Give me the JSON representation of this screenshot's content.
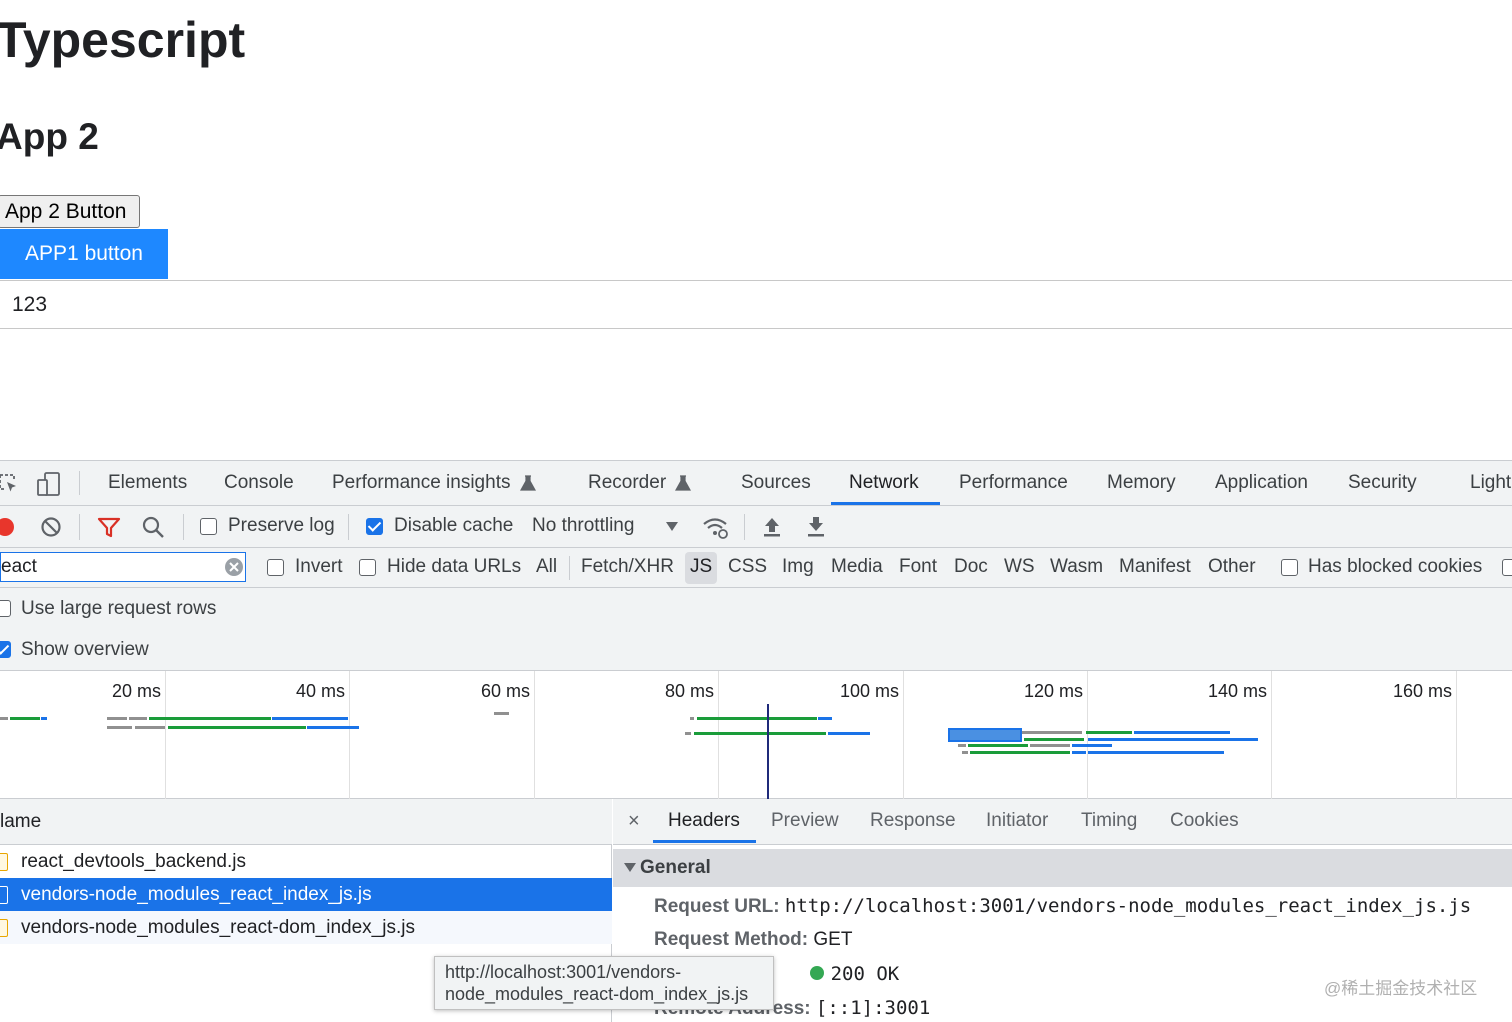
{
  "page": {
    "title": "Typescript",
    "subtitle": "App 2",
    "app2_button": "App 2 Button",
    "app1_button": "APP1 button",
    "value": "123"
  },
  "devtools": {
    "tabs": [
      "Elements",
      "Console",
      "Performance insights",
      "Recorder",
      "Sources",
      "Network",
      "Performance",
      "Memory",
      "Application",
      "Security",
      "Light"
    ],
    "active_tab": "Network",
    "toolbar": {
      "preserve_log": "Preserve log",
      "disable_cache": "Disable cache",
      "throttling": "No throttling"
    },
    "filter": {
      "value": "eact",
      "invert": "Invert",
      "hide_data_urls": "Hide data URLs",
      "types": [
        "All",
        "Fetch/XHR",
        "JS",
        "CSS",
        "Img",
        "Media",
        "Font",
        "Doc",
        "WS",
        "Wasm",
        "Manifest",
        "Other"
      ],
      "active_type": "JS",
      "has_blocked_cookies": "Has blocked cookies"
    },
    "settings": {
      "large_rows": "Use large request rows",
      "show_overview": "Show overview"
    },
    "overview_ticks": [
      "20 ms",
      "40 ms",
      "60 ms",
      "80 ms",
      "100 ms",
      "120 ms",
      "140 ms",
      "160 ms"
    ],
    "request_list": {
      "header": "lame",
      "rows": [
        "react_devtools_backend.js",
        "vendors-node_modules_react_index_js.js",
        "vendors-node_modules_react-dom_index_js.js"
      ],
      "selected_index": 1
    },
    "details": {
      "close": "×",
      "tabs": [
        "Headers",
        "Preview",
        "Response",
        "Initiator",
        "Timing",
        "Cookies"
      ],
      "active_tab": "Headers",
      "section": "General",
      "request_url_label": "Request URL:",
      "request_url": "http://localhost:3001/vendors-node_modules_react_index_js.js",
      "method_label": "Request Method:",
      "method": "GET",
      "status": "200 OK",
      "remote_label": "Remote Address:",
      "remote": "[::1]:3001"
    },
    "tooltip": {
      "line1": "http://localhost:3001/vendors-",
      "line2": "node_modules_react-dom_index_js.js"
    }
  },
  "watermark": "@稀土掘金技术社区",
  "colors": {
    "accent": "#1a73e8",
    "app1_button": "#1e88ff",
    "record": "#e8362c",
    "filter_icon": "#d93025",
    "status_ok": "#34a853"
  }
}
